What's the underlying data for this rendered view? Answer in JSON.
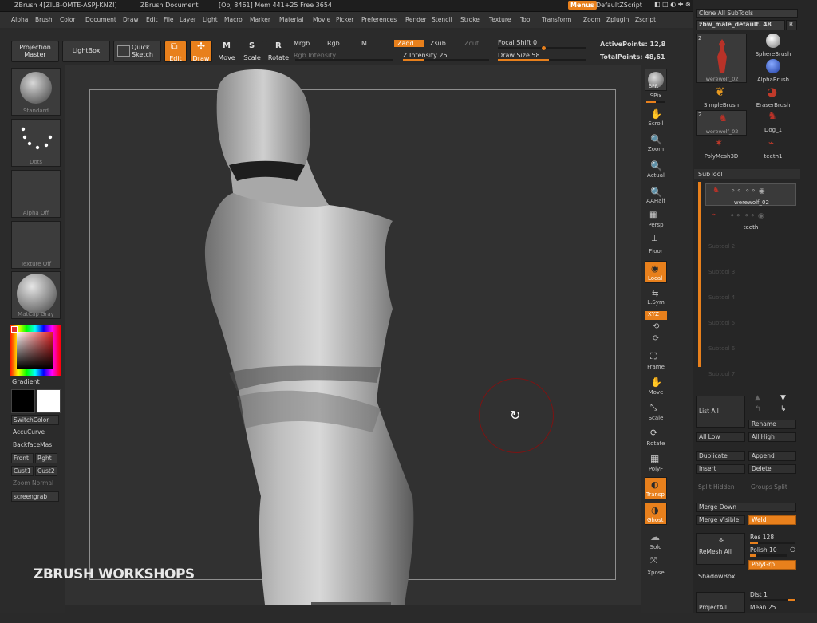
{
  "titlebar": {
    "app": "ZBrush 4[ZILB-OMTE-ASPJ-KNZI]",
    "doc": "ZBrush Document",
    "stats": "[Obj 8461] Mem 441+25 Free 3654",
    "menus_button": "Menus",
    "script": "DefaultZScript"
  },
  "menubar": [
    "Alpha",
    "Brush",
    "Color",
    "Document",
    "Draw",
    "Edit",
    "File",
    "Layer",
    "Light",
    "Macro",
    "Marker",
    "Material",
    "Movie",
    "Picker",
    "Preferences",
    "Render",
    "Stencil",
    "Stroke",
    "Texture",
    "Tool",
    "Transform",
    "Zoom",
    "Zplugin",
    "Zscript"
  ],
  "topbar": {
    "projection_master": "Projection Master",
    "lightbox": "LightBox",
    "quick_sketch": "Quick Sketch",
    "edit": "Edit",
    "draw": "Draw",
    "move": "Move",
    "scale": "Scale",
    "rotate": "Rotate",
    "mrgb": "Mrgb",
    "rgb": "Rgb",
    "m": "M",
    "rgb_intensity": "Rgb Intensity",
    "zadd": "Zadd",
    "zsub": "Zsub",
    "zcut": "Zcut",
    "z_intensity": "Z Intensity 25",
    "focal_shift": "Focal Shift 0",
    "draw_size": "Draw Size 58",
    "active_points": "ActivePoints: 12,8",
    "total_points": "TotalPoints: 48,61",
    "z_intensity_value": 25,
    "draw_size_value": 58
  },
  "leftshelf": {
    "brush": "Standard",
    "stroke": "Dots",
    "alpha": "Alpha Off",
    "texture": "Texture Off",
    "material": "MatCap Gray",
    "gradient": "Gradient",
    "switch_color": "SwitchColor",
    "accu_curve": "AccuCurve",
    "backface": "BackfaceMas",
    "front": "Front",
    "right": "Rght",
    "cust1": "Cust1",
    "cust2": "Cust2",
    "zoom_normal": "Zoom Normal",
    "screengrab": "screengrab"
  },
  "rightshelf": {
    "bpr": "BPR",
    "spix": "SPix",
    "scroll": "Scroll",
    "zoom": "Zoom",
    "actual": "Actual",
    "aahalf": "AAHalf",
    "persp": "Persp",
    "floor": "Floor",
    "local": "Local",
    "lsym": "L.Sym",
    "xyz": "XYZ",
    "frame": "Frame",
    "move": "Move",
    "scale": "Scale",
    "rotate": "Rotate",
    "polyf": "PolyF",
    "transp": "Transp",
    "ghost": "Ghost",
    "solo": "Solo",
    "xpose": "Xpose"
  },
  "tray": {
    "clone_all": "Clone All SubTools",
    "tool_name": "zbw_male_default. 48",
    "r": "R",
    "tools": [
      {
        "label": "werewolf_02",
        "num": "2"
      },
      {
        "label": "SphereBrush"
      },
      {
        "label": "AlphaBrush"
      },
      {
        "label": "SimpleBrush"
      },
      {
        "label": "EraserBrush"
      },
      {
        "label": "werewolf_02",
        "num": "2"
      },
      {
        "label": "Dog_1"
      },
      {
        "label": "PolyMesh3D"
      },
      {
        "label": "teeth1"
      }
    ],
    "subtool_header": "SubTool",
    "subtools": [
      "werewolf_02",
      "teeth"
    ],
    "empty_slots": [
      "Subtool 2",
      "Subtool 3",
      "Subtool 4",
      "Subtool 5",
      "Subtool 6",
      "Subtool 7"
    ],
    "list_all": "List All",
    "rename": "Rename",
    "all_low": "All Low",
    "all_high": "All High",
    "duplicate": "Duplicate",
    "append": "Append",
    "insert": "Insert",
    "delete": "Delete",
    "split_hidden": "Split Hidden",
    "groups_split": "Groups Split",
    "merge_down": "Merge Down",
    "merge_visible": "Merge Visible",
    "weld": "Weld",
    "remesh_all": "ReMesh All",
    "res": "Res 128",
    "polish": "Polish 10",
    "polygrp": "PolyGrp",
    "shadowbox": "ShadowBox",
    "project_all": "ProjectAll",
    "dist": "Dist 1",
    "mean": "Mean 25"
  },
  "watermark": "ZBRUSH WORKSHOPS"
}
